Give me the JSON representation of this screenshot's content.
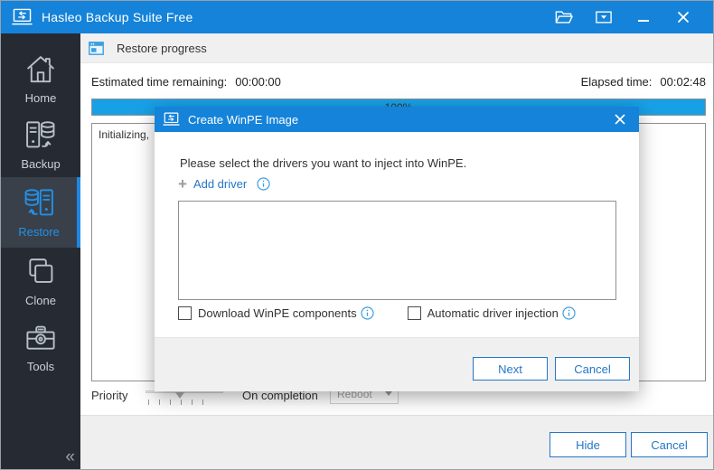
{
  "colors": {
    "titlebar": "#1583d9",
    "accent": "#1e88e5",
    "button_blue": "#2577c8",
    "progress_fill": "#18a0e6",
    "sidebar_bg": "#262b33",
    "info": "#3f9fe0"
  },
  "window": {
    "title": "Hasleo Backup Suite Free"
  },
  "sidebar": {
    "items": [
      {
        "label": "Home"
      },
      {
        "label": "Backup"
      },
      {
        "label": "Restore",
        "active": true
      },
      {
        "label": "Clone"
      },
      {
        "label": "Tools"
      }
    ],
    "collapse_glyph": "«"
  },
  "header": {
    "title": "Restore progress"
  },
  "progress": {
    "estimated_label": "Estimated time remaining:",
    "estimated_value": "00:00:00",
    "elapsed_label": "Elapsed time:",
    "elapsed_value": "00:02:48",
    "percent": "100%",
    "log_text": "Initializing,"
  },
  "controls": {
    "priority_label": "Priority",
    "on_completion_label": "On completion",
    "on_completion_value": "Reboot"
  },
  "bottombar": {
    "hide_label": "Hide",
    "cancel_label": "Cancel"
  },
  "dialog": {
    "title": "Create WinPE Image",
    "message": "Please select the drivers you want to inject into WinPE.",
    "add_driver_plus": "+",
    "add_driver_label": "Add driver",
    "checkbox1_label": "Download WinPE components",
    "checkbox2_label": "Automatic driver injection",
    "next_label": "Next",
    "cancel_label": "Cancel"
  }
}
